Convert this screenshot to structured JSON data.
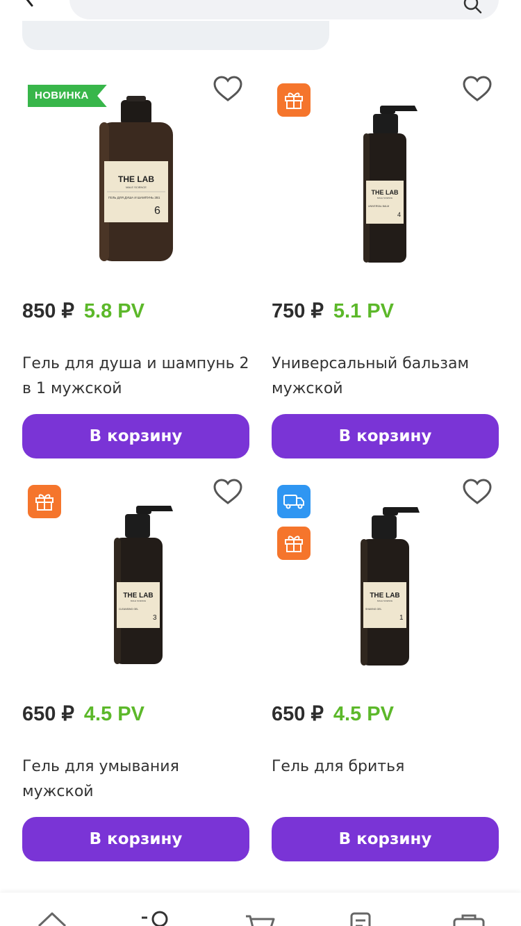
{
  "header": {
    "back_icon": "chevron-left-icon",
    "search_icon": "search-icon"
  },
  "products": [
    {
      "badges": [
        "new"
      ],
      "badge_new_label": "НОВИНКА",
      "price": "850 ₽",
      "pv": "5.8 PV",
      "title": "Гель для душа и шампунь 2 в 1 мужской",
      "button_label": "В корзину",
      "image": {
        "brand": "THE LAB",
        "sub": "MALE SCIENCE",
        "label": "ГЕЛЬ ДЛЯ ДУША И ШАМПУНЬ 2В1",
        "number": "6"
      }
    },
    {
      "badges": [
        "gift"
      ],
      "price": "750 ₽",
      "pv": "5.1 PV",
      "title": "Универсальный бальзам мужской",
      "button_label": "В корзину",
      "image": {
        "brand": "THE LAB",
        "sub": "MALE SCIENCE",
        "label": "UNIVERSAL BALM",
        "number": "4"
      }
    },
    {
      "badges": [
        "gift"
      ],
      "price": "650 ₽",
      "pv": "4.5 PV",
      "title": "Гель для умывания мужской",
      "button_label": "В корзину",
      "image": {
        "brand": "THE LAB",
        "sub": "MALE SCIENCE",
        "label": "CLEANSING GEL",
        "number": "3"
      }
    },
    {
      "badges": [
        "delivery",
        "gift"
      ],
      "price": "650 ₽",
      "pv": "4.5 PV",
      "title": "Гель для бритья",
      "button_label": "В корзину",
      "image": {
        "brand": "THE LAB",
        "sub": "MALE SCIENCE",
        "label": "SHAVING GEL",
        "number": "1"
      }
    }
  ],
  "bottom_nav": {
    "items": [
      {
        "icon": "home-icon"
      },
      {
        "icon": "catalog-search-icon"
      },
      {
        "icon": "cart-icon"
      },
      {
        "icon": "orders-icon"
      },
      {
        "icon": "profile-bag-icon"
      }
    ]
  },
  "colors": {
    "accent": "#7a34d6",
    "pv_green": "#5cb82a",
    "badge_new": "#38b64a",
    "badge_gift": "#f5752c",
    "badge_delivery": "#2f96f2"
  }
}
